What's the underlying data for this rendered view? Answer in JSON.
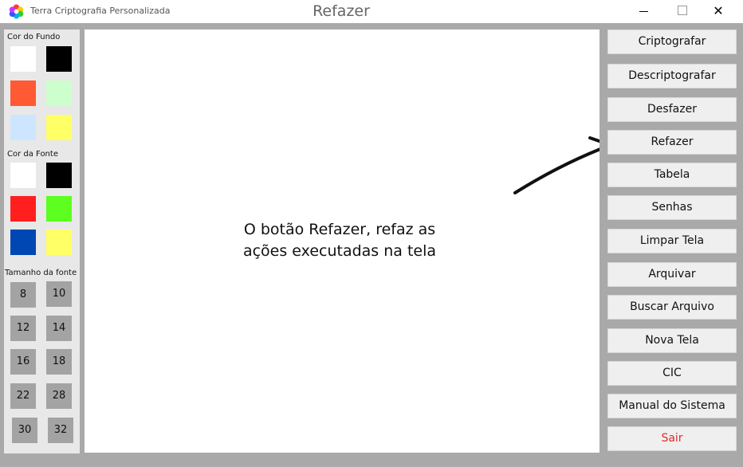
{
  "window": {
    "app_title": "Terra Criptografia Personalizada",
    "center_title": "Refazer",
    "minimize_glyph": "",
    "close_glyph": "✕"
  },
  "left_panel": {
    "background_label": "Cor do Fundo",
    "background_colors": [
      "#ffffff",
      "#000000",
      "#ff5a33",
      "#ccffcc",
      "#cce6ff",
      "#ffff66"
    ],
    "font_label": "Cor da Fonte",
    "font_colors": [
      "#ffffff",
      "#000000",
      "#ff1f1f",
      "#5cff1f",
      "#0047b3",
      "#ffff66"
    ],
    "size_label": "Tamanho da fonte",
    "sizes": [
      "8",
      "10",
      "12",
      "14",
      "16",
      "18",
      "22",
      "28",
      "30",
      "32"
    ]
  },
  "canvas": {
    "text_line1": "O botão Refazer, refaz as",
    "text_line2": "ações executadas na tela"
  },
  "right_panel": {
    "buttons": [
      "Criptografar",
      "Descriptografar",
      "Desfazer",
      "Refazer",
      "Tabela",
      "Senhas",
      "Limpar Tela",
      "Arquivar",
      "Buscar Arquivo",
      "Nova Tela",
      "CIC",
      "Manual do Sistema",
      "Sair"
    ]
  },
  "colors": {
    "exit_text": "#e02b2b",
    "frame_gray": "#a9a9a9"
  }
}
